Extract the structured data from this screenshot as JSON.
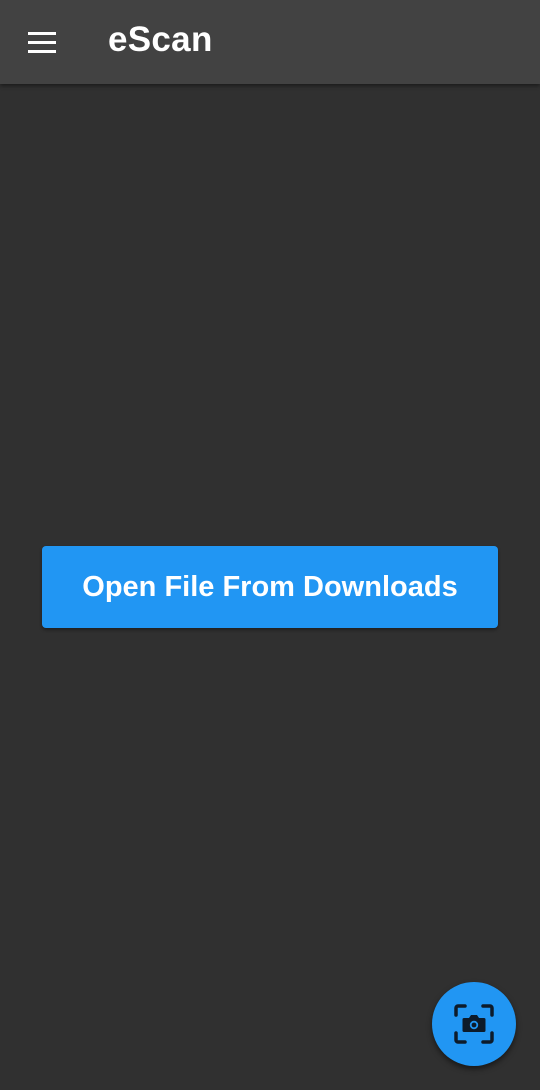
{
  "app": {
    "title": "eScan"
  },
  "appbar": {
    "menu_icon": "hamburger-menu-icon"
  },
  "main": {
    "open_button_label": "Open File From Downloads"
  },
  "fab": {
    "icon": "camera-scan-icon"
  },
  "colors": {
    "background": "#303030",
    "appbar": "#424242",
    "accent": "#2196f3",
    "text": "#ffffff"
  }
}
